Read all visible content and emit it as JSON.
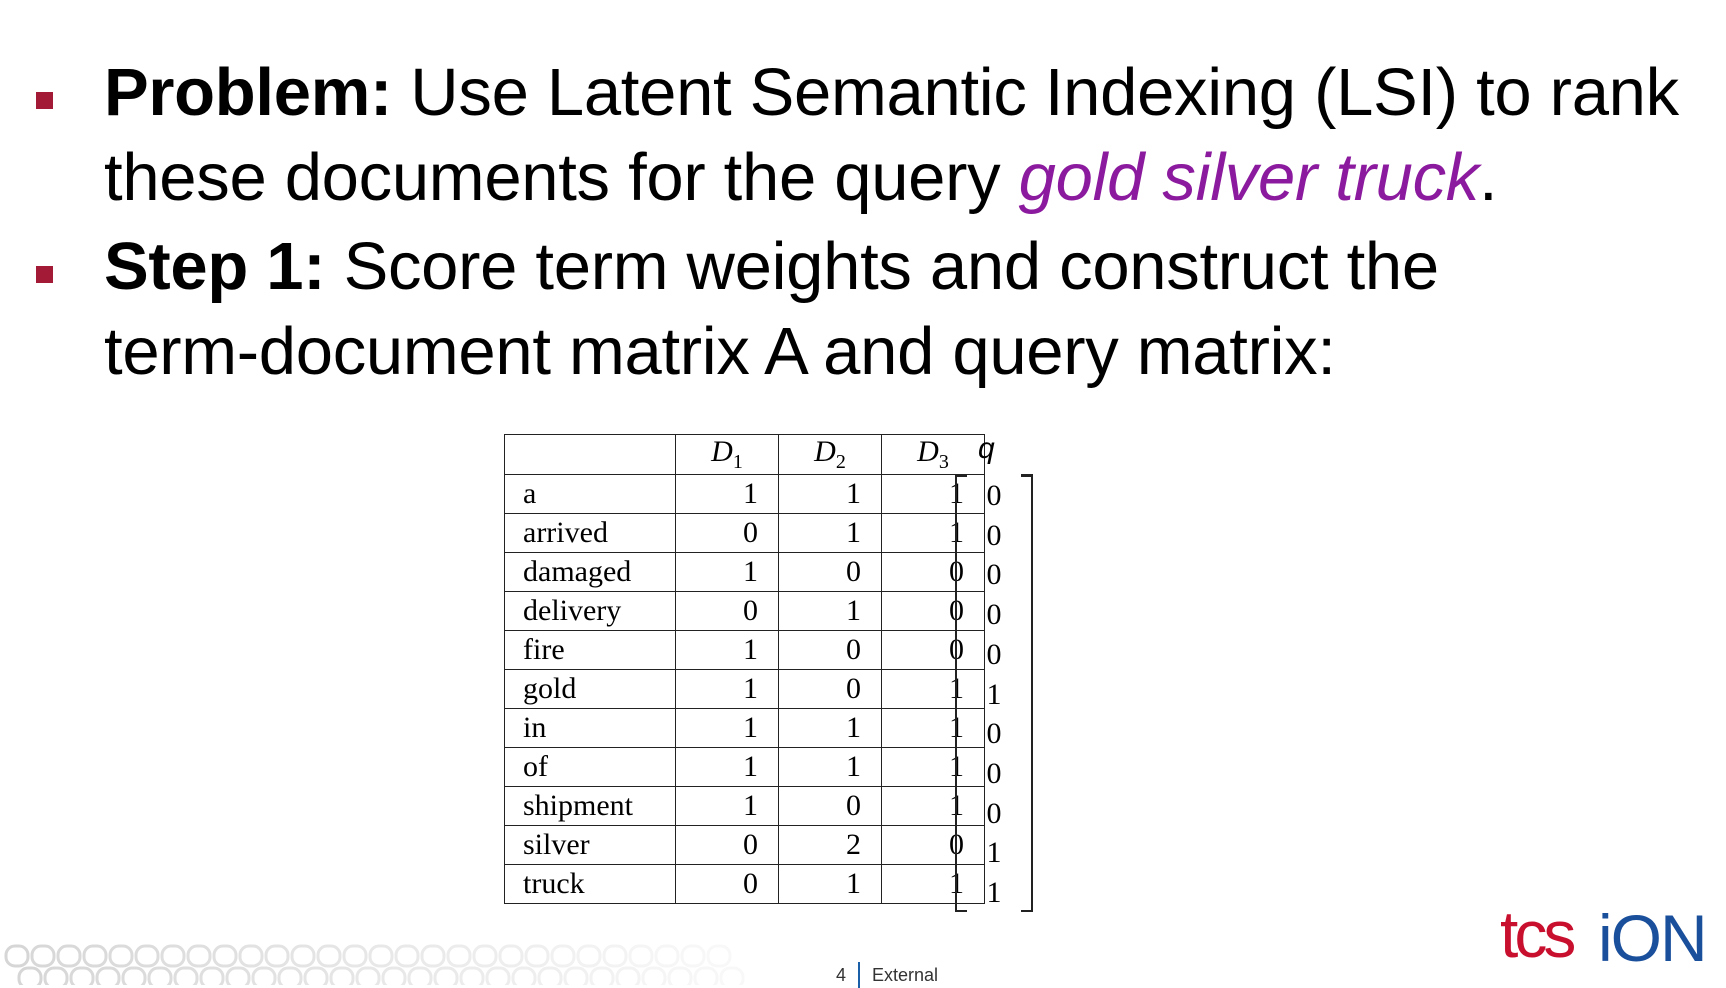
{
  "slide": {
    "problem": {
      "label": "Problem:",
      "text_before": " Use Latent Semantic Indexing (LSI) to rank these documents for the query ",
      "query": "gold silver truck",
      "text_after": "."
    },
    "step1": {
      "label": "Step 1:",
      "text": " Score term weights and construct the term-document matrix A and query matrix:"
    }
  },
  "matrix": {
    "headers": [
      {
        "letter": "D",
        "sub": "1"
      },
      {
        "letter": "D",
        "sub": "2"
      },
      {
        "letter": "D",
        "sub": "3"
      }
    ],
    "rows": [
      {
        "term": "a",
        "d1": "1",
        "d2": "1",
        "d3": "1"
      },
      {
        "term": "arrived",
        "d1": "0",
        "d2": "1",
        "d3": "1"
      },
      {
        "term": "damaged",
        "d1": "1",
        "d2": "0",
        "d3": "0"
      },
      {
        "term": "delivery",
        "d1": "0",
        "d2": "1",
        "d3": "0"
      },
      {
        "term": "fire",
        "d1": "1",
        "d2": "0",
        "d3": "0"
      },
      {
        "term": "gold",
        "d1": "1",
        "d2": "0",
        "d3": "1"
      },
      {
        "term": "in",
        "d1": "1",
        "d2": "1",
        "d3": "1"
      },
      {
        "term": "of",
        "d1": "1",
        "d2": "1",
        "d3": "1"
      },
      {
        "term": "shipment",
        "d1": "1",
        "d2": "0",
        "d3": "1"
      },
      {
        "term": "silver",
        "d1": "0",
        "d2": "2",
        "d3": "0"
      },
      {
        "term": "truck",
        "d1": "0",
        "d2": "1",
        "d3": "1"
      }
    ]
  },
  "query_vector": {
    "label": "q",
    "values": [
      "0",
      "0",
      "0",
      "0",
      "0",
      "1",
      "0",
      "0",
      "0",
      "1",
      "1"
    ]
  },
  "footer": {
    "page_number": "4",
    "classification": "External"
  },
  "logo": {
    "left": "tcs",
    "right": "iON"
  },
  "colors": {
    "bullet": "#a31a36",
    "query_term": "#8b1a9e",
    "logo_red": "#c8102e",
    "logo_blue": "#1a4f9c"
  }
}
